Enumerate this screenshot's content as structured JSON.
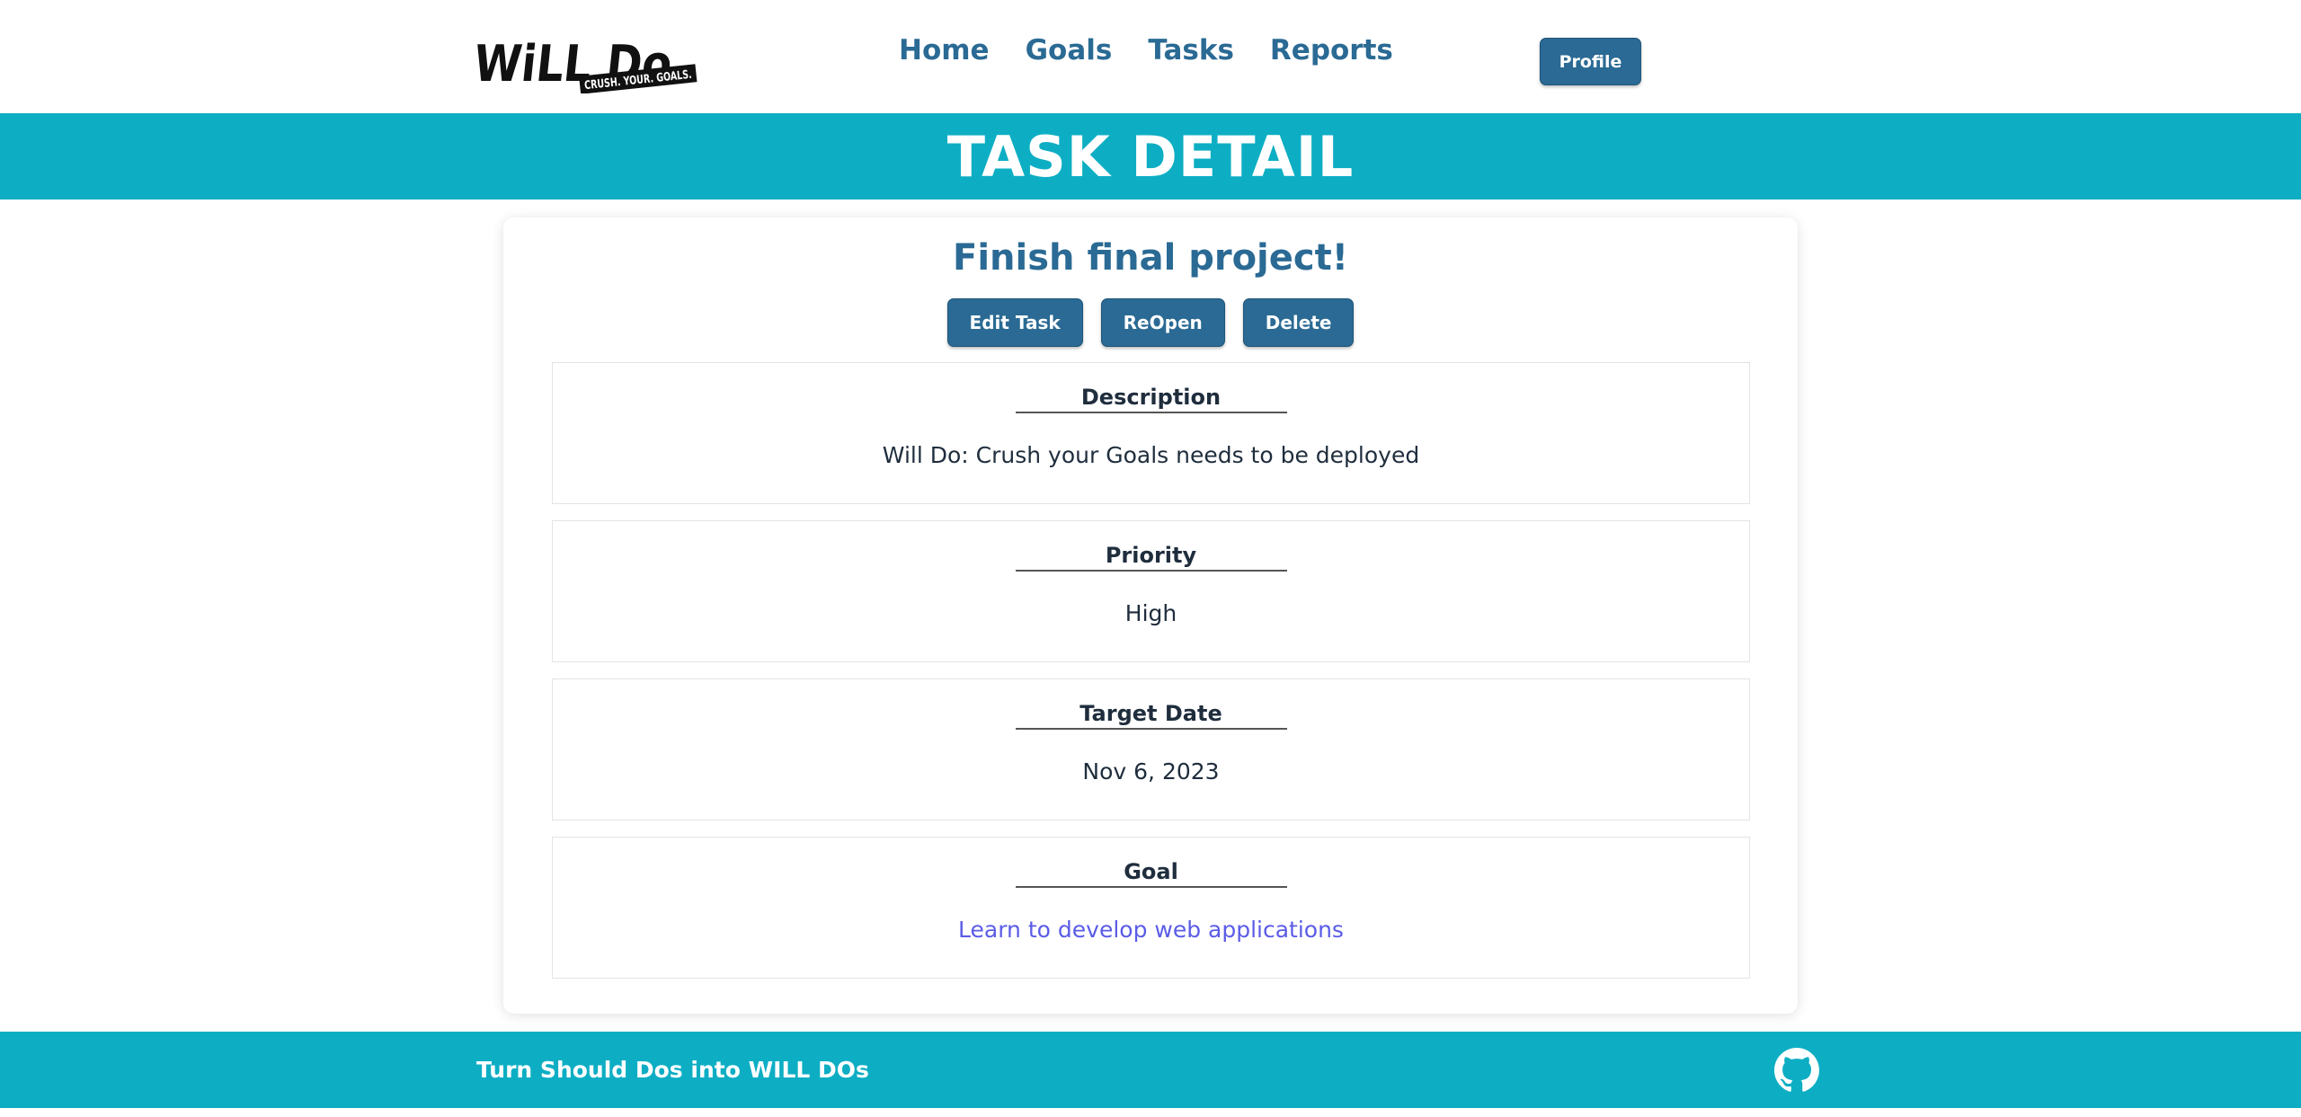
{
  "brand": {
    "logo_main": "WiLL Do",
    "logo_tagline": "CRUSH. YOUR. GOALS."
  },
  "nav": {
    "items": [
      {
        "label": "Home"
      },
      {
        "label": "Goals"
      },
      {
        "label": "Tasks"
      },
      {
        "label": "Reports"
      }
    ],
    "profile_label": "Profile"
  },
  "banner": {
    "title": "TASK DETAIL"
  },
  "task": {
    "title": "Finish final project!",
    "actions": {
      "edit_label": "Edit Task",
      "reopen_label": "ReOpen",
      "delete_label": "Delete"
    },
    "sections": [
      {
        "label": "Description",
        "value": "Will Do: Crush your Goals needs to be deployed"
      },
      {
        "label": "Priority",
        "value": "High"
      },
      {
        "label": "Target Date",
        "value": "Nov 6, 2023"
      },
      {
        "label": "Goal",
        "value": "Learn to develop web applications"
      }
    ]
  },
  "footer": {
    "tagline": "Turn Should Dos into WILL DOs",
    "icon": "github-icon"
  },
  "colors": {
    "accent_teal": "#0daec4",
    "primary_blue": "#2a6a94",
    "link_purple": "#5b5ce6"
  }
}
